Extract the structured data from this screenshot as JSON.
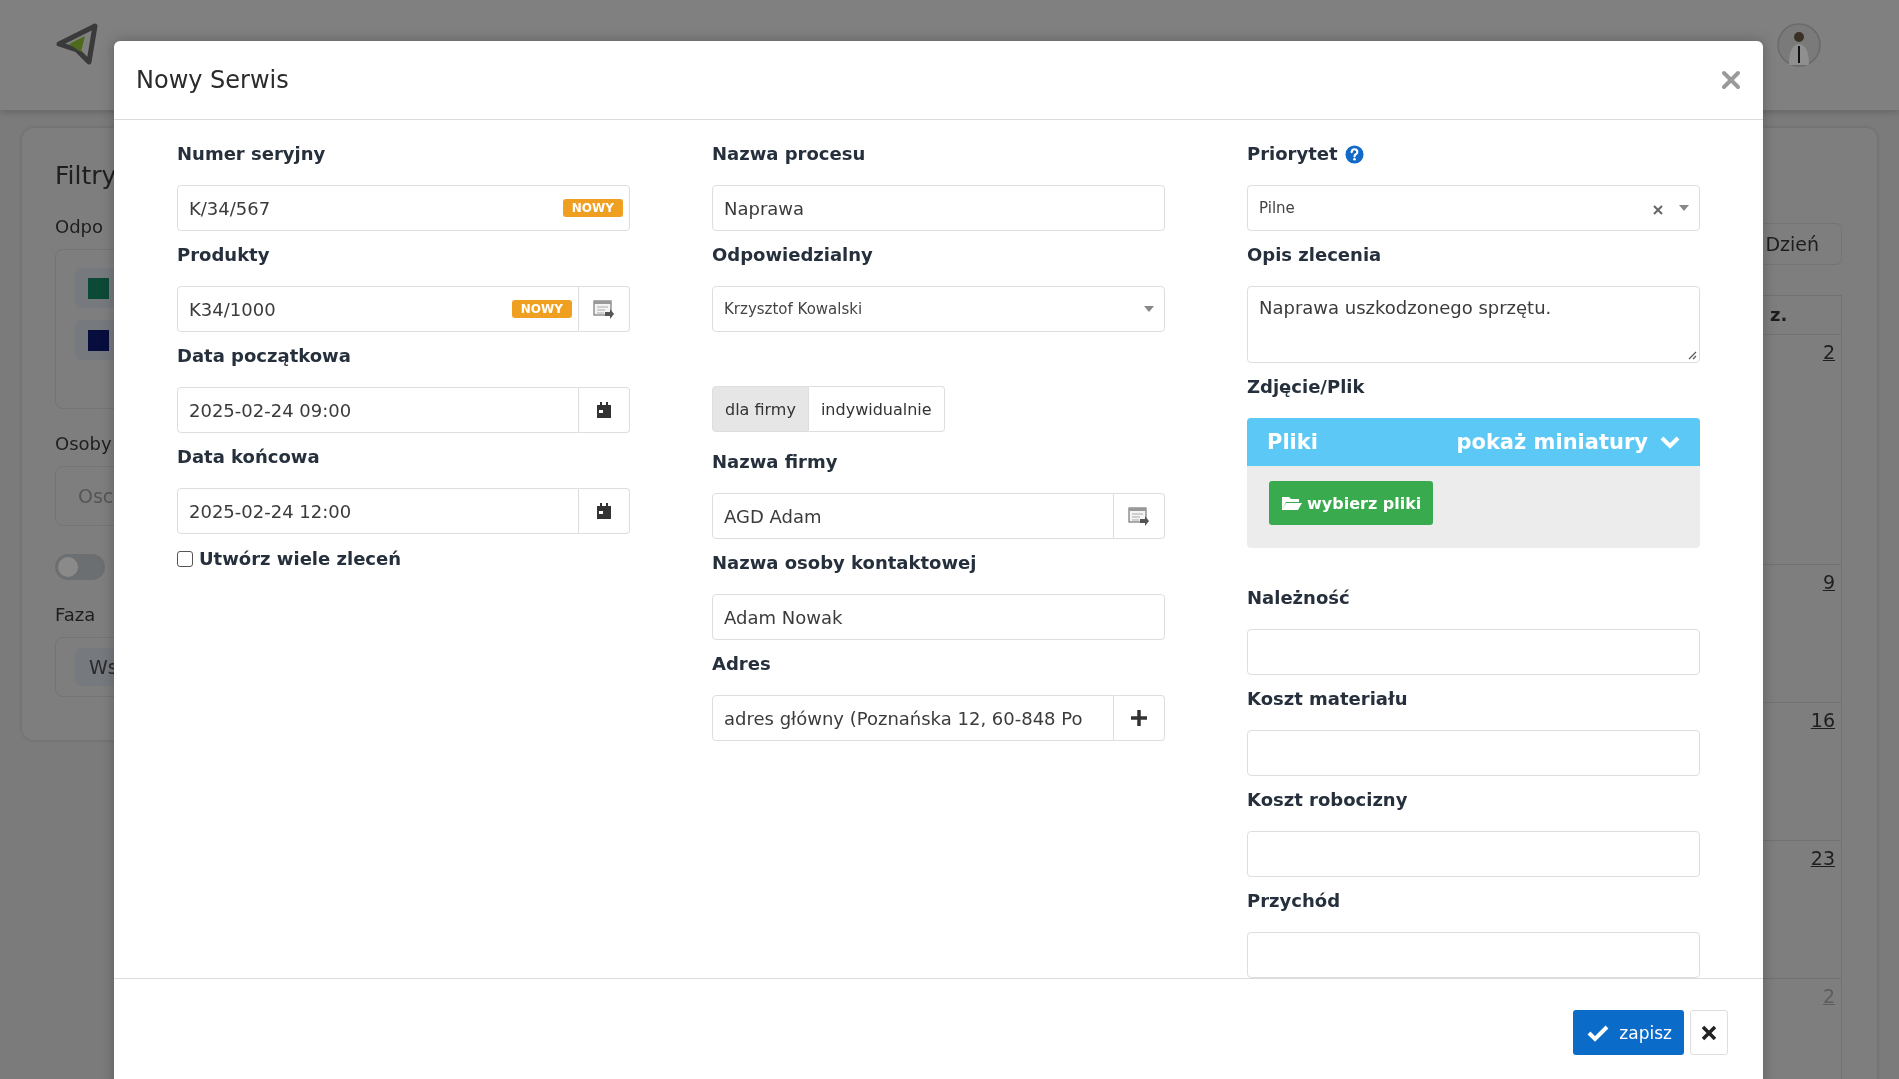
{
  "background": {
    "filters": {
      "title": "Filtry",
      "responsible_label": "Odpo",
      "swatches": [
        {
          "color": "#0c4a36"
        },
        {
          "color": "#070d3d"
        }
      ],
      "people_label": "Osoby",
      "people_placeholder": "Osc",
      "toggle": {
        "on": false
      },
      "phase_label": "Faza",
      "phase_chip": "Ws"
    },
    "calendar": {
      "view_button": "Dzień",
      "column_header": "z.",
      "days": [
        {
          "label": "2",
          "muted": false
        },
        {
          "label": "9",
          "muted": false
        },
        {
          "label": "16",
          "muted": false
        },
        {
          "label": "23",
          "muted": false
        },
        {
          "label": "2",
          "muted": true
        }
      ]
    }
  },
  "modal": {
    "title": "Nowy Serwis",
    "columns": [
      {
        "fields": [
          {
            "kind": "input",
            "label": "Numer seryjny",
            "value": "K/34/567",
            "badge": "NOWY"
          },
          {
            "kind": "input",
            "label": "Produkty",
            "value": "K34/1000",
            "badge": "NOWY",
            "addon": {
              "kind": "picker"
            }
          },
          {
            "kind": "input",
            "label": "Data początkowa",
            "value": "2025-02-24 09:00",
            "addon": {
              "kind": "calendar"
            }
          },
          {
            "kind": "input",
            "label": "Data końcowa",
            "value": "2025-02-24 12:00",
            "addon": {
              "kind": "calendar"
            }
          },
          {
            "kind": "checkbox",
            "label": "Utwórz wiele zleceń",
            "checked": false
          }
        ]
      },
      {
        "fields": [
          {
            "kind": "input",
            "label": "Nazwa procesu",
            "value": "Naprawa"
          },
          {
            "kind": "select",
            "label": "Odpowiedzialny",
            "value": "Krzysztof Kowalski",
            "clearable": false
          },
          {
            "kind": "segmented",
            "options": [
              {
                "label": "dla firmy",
                "selected": true
              },
              {
                "label": "indywidualnie",
                "selected": false
              }
            ]
          },
          {
            "kind": "input",
            "label": "Nazwa firmy",
            "value": "AGD Adam",
            "addon": {
              "kind": "picker"
            }
          },
          {
            "kind": "input",
            "label": "Nazwa osoby kontaktowej",
            "value": "Adam Nowak"
          },
          {
            "kind": "input",
            "label": "Adres",
            "value": "adres główny (Poznańska 12, 60-848 Po",
            "addon": {
              "kind": "plus"
            }
          }
        ]
      },
      {
        "fields": [
          {
            "kind": "select",
            "label": "Priorytet",
            "help": true,
            "value": "Pilne",
            "clearable": true
          },
          {
            "kind": "textarea",
            "label": "Opis zlecenia",
            "value": "Naprawa uszkodzonego sprzętu."
          },
          {
            "kind": "files",
            "label": "Zdjęcie/Plik",
            "panel_title": "Pliki",
            "toggle_label": "pokaż miniatury",
            "button": "wybierz pliki"
          },
          {
            "kind": "input",
            "label": "Należność"
          },
          {
            "kind": "input",
            "label": "Koszt materiału"
          },
          {
            "kind": "input",
            "label": "Koszt robocizny"
          },
          {
            "kind": "input",
            "label": "Przychód"
          }
        ]
      }
    ],
    "save_button": "zapisz"
  }
}
